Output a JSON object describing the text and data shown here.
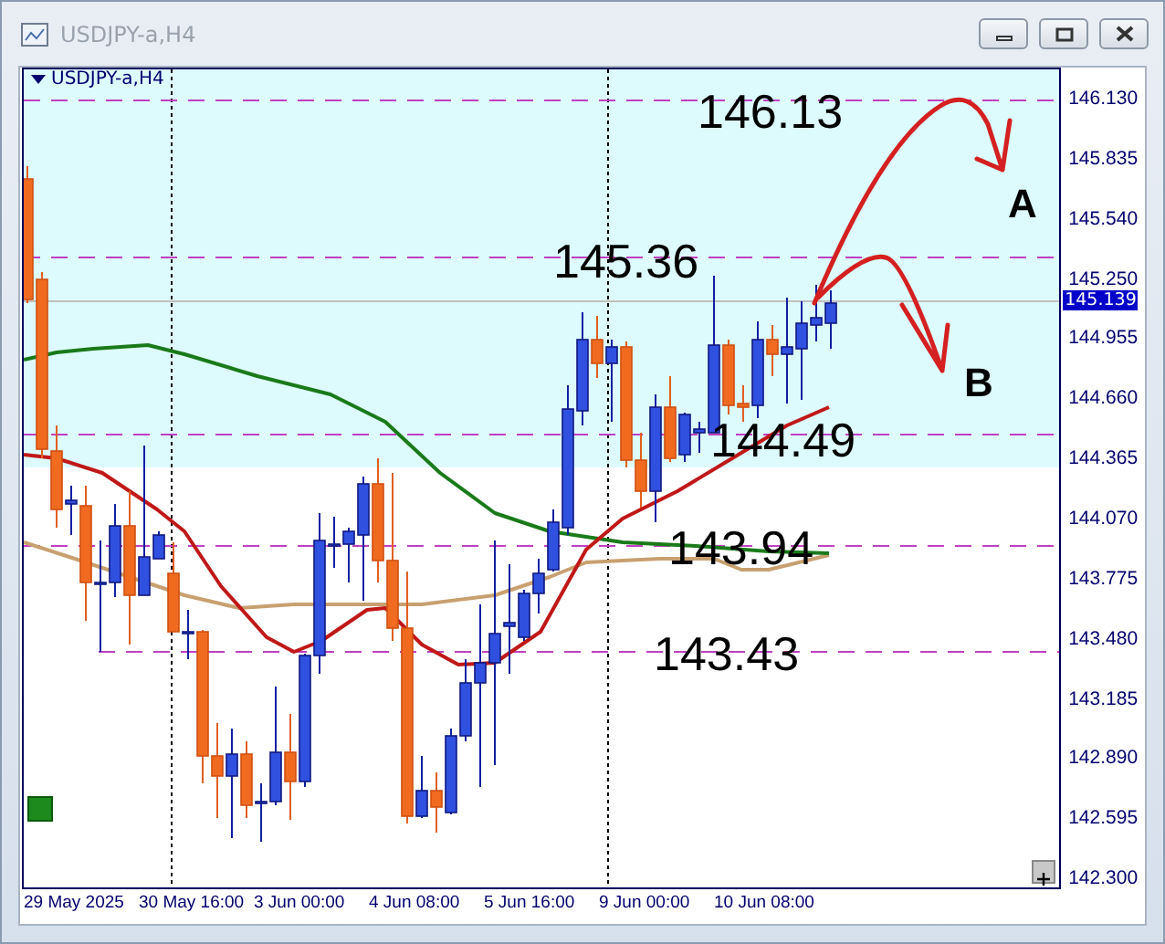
{
  "window": {
    "title": "USDJPY-a,H4"
  },
  "chart": {
    "label": "USDJPY-a,H4",
    "levels": [
      {
        "label": "146.13"
      },
      {
        "label": "145.36"
      },
      {
        "label": "144.49"
      },
      {
        "label": "143.94"
      },
      {
        "label": "143.43"
      }
    ],
    "annotations": [
      {
        "label": "A"
      },
      {
        "label": "B"
      }
    ],
    "price_axis": {
      "ticks": [
        "146.130",
        "145.835",
        "145.540",
        "145.250",
        "144.955",
        "144.660",
        "144.365",
        "144.070",
        "143.775",
        "143.480",
        "143.185",
        "142.890",
        "142.595",
        "142.300"
      ],
      "current_price": "145.139"
    },
    "time_axis": {
      "labels": [
        "29 May 2025",
        "30 May 16:00",
        "3 Jun 00:00",
        "4 Jun 08:00",
        "5 Jun 16:00",
        "9 Jun 00:00",
        "10 Jun 08:00"
      ]
    }
  }
}
